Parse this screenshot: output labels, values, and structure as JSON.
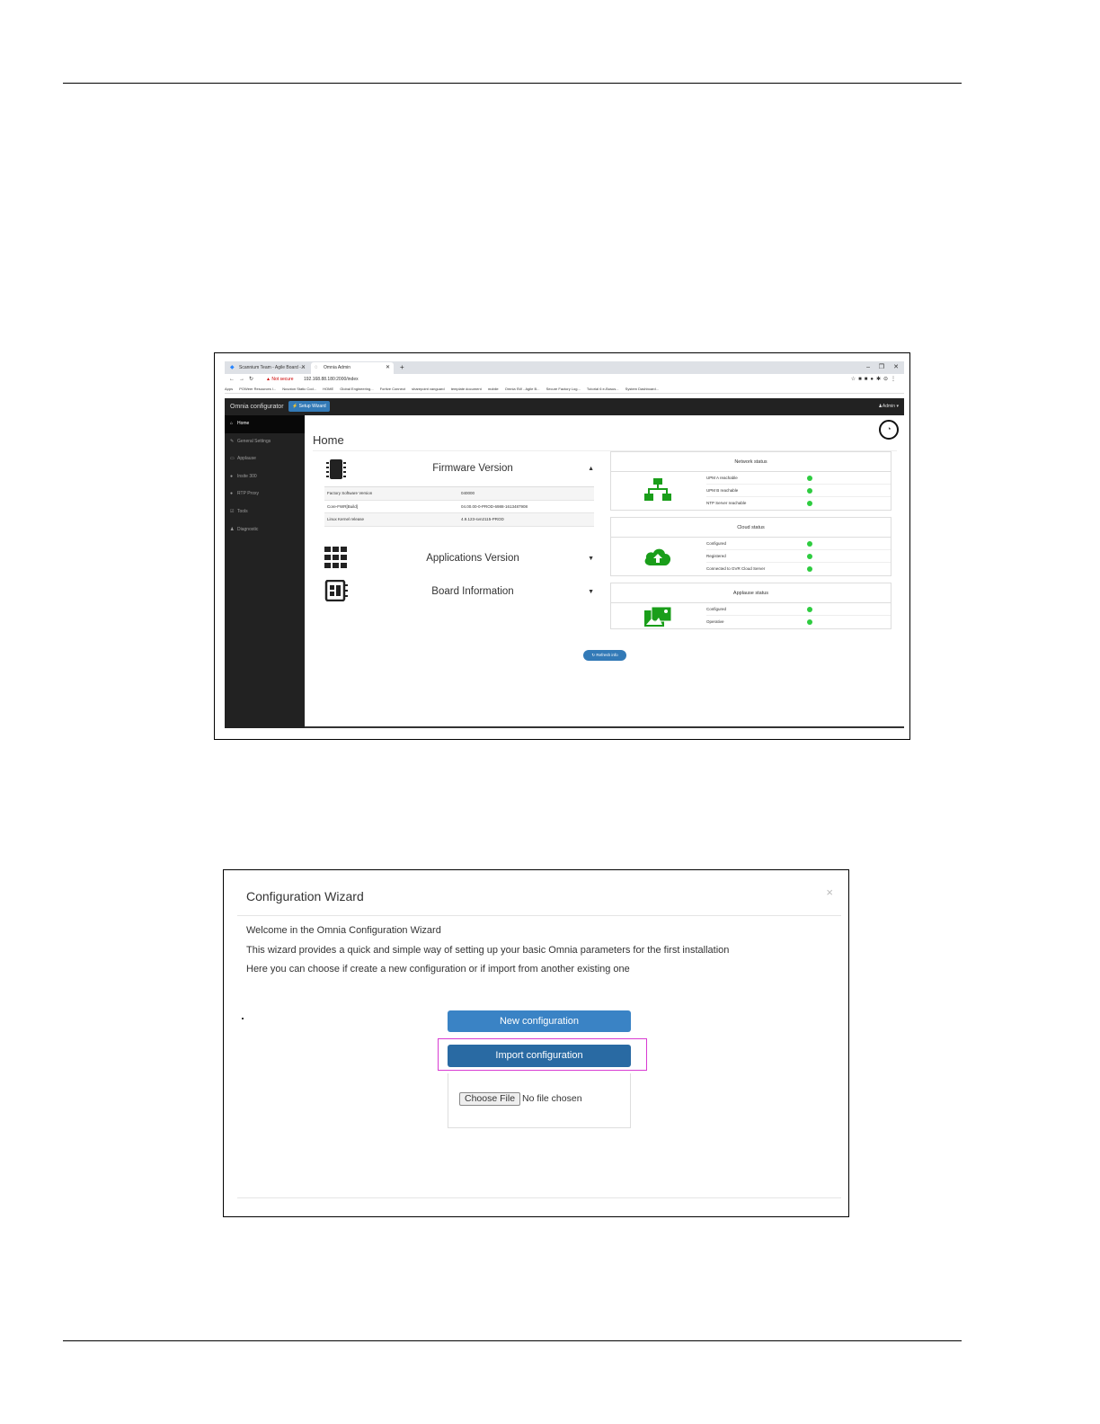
{
  "browser": {
    "tabs": [
      {
        "label": "Scannium Team - Agile Board -..."
      },
      {
        "label": "Omnia Admin"
      }
    ],
    "new_tab": "+",
    "window_controls": {
      "minimize": "–",
      "restore": "❐",
      "close": "✕"
    },
    "security": "Not secure",
    "url": "192.168.88.180:2000/index",
    "bookmarks": [
      "Apps",
      "POWeer Resources l...",
      "Nuvoton Static Cod...",
      "HOME",
      "Global Engineering...",
      "Fortive Connect",
      "sharepoint vanguard",
      "template document",
      "mobile",
      "Omnia SW - Agile B...",
      "Secure Factory Log...",
      "Tutorial 6 e-Busus...",
      "System Dashboard..."
    ]
  },
  "app": {
    "brand": "Omnia configurator",
    "setup_wizard": "Setup Wizard",
    "admin": "Admin",
    "sidebar": [
      {
        "label": "Home",
        "icon": "home-icon"
      },
      {
        "label": "General Settings",
        "icon": "wrench-icon"
      },
      {
        "label": "Applause",
        "icon": "monitor-icon"
      },
      {
        "label": "Insite 300",
        "icon": "circle-icon"
      },
      {
        "label": "RTP Proxy",
        "icon": "circle-icon"
      },
      {
        "label": "Tools",
        "icon": "edit-icon"
      },
      {
        "label": "Diagnostic",
        "icon": "user-icon"
      }
    ],
    "home_title": "Home",
    "firmware": {
      "title": "Firmware Version",
      "rows": [
        {
          "key": "Factory Software Version",
          "value": "040000"
        },
        {
          "key": "Core-FWR[Build]",
          "value": "04.00.00-0-PROD-6988-1613487908"
        },
        {
          "key": "Linux Kernel release",
          "value": "4.9.123-svn2115-PROD"
        }
      ]
    },
    "applications_version": "Applications Version",
    "board_information": "Board Information",
    "network_status": {
      "title": "Network status",
      "rows": [
        "UPM A reachable",
        "UPM B reachable",
        "NTP Server reachable"
      ]
    },
    "cloud_status": {
      "title": "Cloud status",
      "rows": [
        "Configured",
        "Registered",
        "Connected to GVR Cloud Server"
      ]
    },
    "applause_status": {
      "title": "Applause status",
      "rows": [
        "Configured",
        "Operative"
      ]
    },
    "refresh": "Refresh info",
    "status_color": "#2ecc40"
  },
  "wizard": {
    "title": "Configuration Wizard",
    "close": "×",
    "lines": [
      "Welcome in the Omnia Configuration Wizard",
      "This wizard provides a quick and simple way of setting up your basic Omnia parameters for the first installation",
      "Here you can choose if create a new configuration or if import from another existing one"
    ],
    "new_configuration": "New configuration",
    "import_configuration": "Import configuration",
    "choose_file": "Choose File",
    "no_file": "No file chosen",
    "highlight_color": "#d83bd2"
  }
}
